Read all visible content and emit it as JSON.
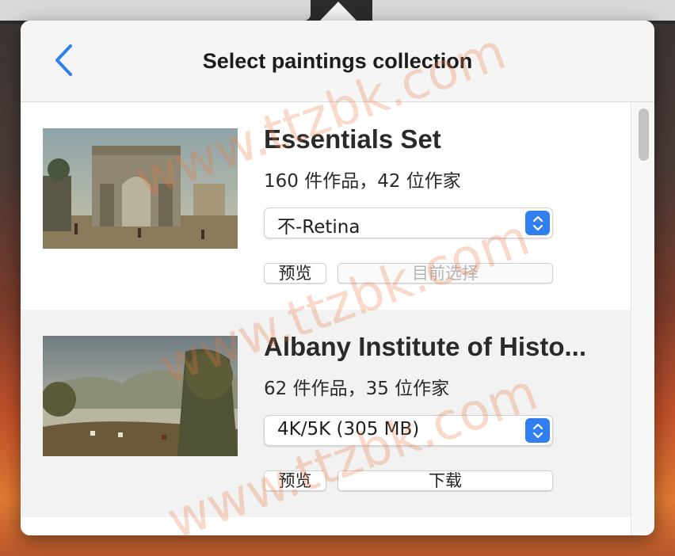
{
  "header": {
    "title": "Select paintings collection"
  },
  "collections": [
    {
      "name": "Essentials Set",
      "meta": "160 件作品，42 位作家",
      "resolution": "不-Retina",
      "preview_label": "预览",
      "action_label": "目前选择",
      "action_enabled": false
    },
    {
      "name": "Albany Institute of Histo...",
      "meta": "62 件作品，35 位作家",
      "resolution": "4K/5K (305 MB)",
      "preview_label": "预览",
      "action_label": "下载",
      "action_enabled": true
    }
  ],
  "watermark": "www.ttzbk.com",
  "colors": {
    "accent": "#2f7ff0",
    "back_chevron": "#2f7ff0"
  }
}
